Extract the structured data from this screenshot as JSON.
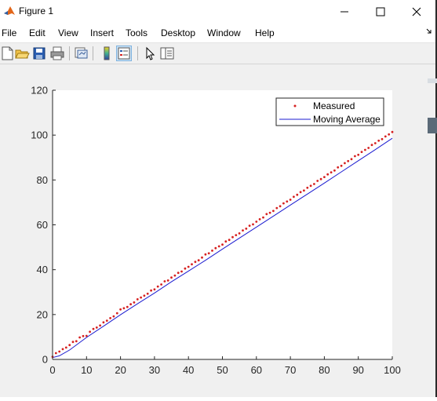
{
  "window": {
    "title": "Figure 1",
    "controls": [
      "minimize",
      "maximize",
      "close"
    ]
  },
  "menu": {
    "items": [
      "File",
      "Edit",
      "View",
      "Insert",
      "Tools",
      "Desktop",
      "Window",
      "Help"
    ]
  },
  "toolbar": {
    "buttons": [
      "new-figure-icon",
      "open-file-icon",
      "save-icon",
      "print-icon",
      "link-plot-icon",
      "insert-colorbar-icon",
      "insert-legend-icon",
      "pointer-icon",
      "property-inspector-icon"
    ],
    "active": "insert-legend-icon"
  },
  "colors": {
    "measured": "#d62020",
    "moving_average": "#1b1bd0",
    "figure_bg": "#f0f0f0",
    "axes_bg": "#ffffff"
  },
  "chart_data": {
    "type": "line",
    "xlim": [
      0,
      100
    ],
    "ylim": [
      0,
      120
    ],
    "xticks": [
      0,
      10,
      20,
      30,
      40,
      50,
      60,
      70,
      80,
      90,
      100
    ],
    "yticks": [
      0,
      20,
      40,
      60,
      80,
      100,
      120
    ],
    "grid": false,
    "legend_position": "top-right",
    "series": [
      {
        "name": "Measured",
        "style": "dots",
        "x": [
          0,
          1,
          2,
          3,
          4,
          5,
          6,
          7,
          8,
          9,
          10,
          11,
          12,
          13,
          14,
          15,
          16,
          17,
          18,
          19,
          20,
          21,
          22,
          23,
          24,
          25,
          26,
          27,
          28,
          29,
          30,
          31,
          32,
          33,
          34,
          35,
          36,
          37,
          38,
          39,
          40,
          41,
          42,
          43,
          44,
          45,
          46,
          47,
          48,
          49,
          50,
          51,
          52,
          53,
          54,
          55,
          56,
          57,
          58,
          59,
          60,
          61,
          62,
          63,
          64,
          65,
          66,
          67,
          68,
          69,
          70,
          71,
          72,
          73,
          74,
          75,
          76,
          77,
          78,
          79,
          80,
          81,
          82,
          83,
          84,
          85,
          86,
          87,
          88,
          89,
          90,
          91,
          92,
          93,
          94,
          95,
          96,
          97,
          98,
          99,
          100
        ],
        "values": [
          1.2,
          2.8,
          3.5,
          4.6,
          5.3,
          6.4,
          7.8,
          8.1,
          9.8,
          10.4,
          10.5,
          12.3,
          13.6,
          14.2,
          15.1,
          16.5,
          17.3,
          18.4,
          19.2,
          20.6,
          22.3,
          22.8,
          23.4,
          24.6,
          25.4,
          26.8,
          27.6,
          28.4,
          29.3,
          30.7,
          31.2,
          32.5,
          33.4,
          34.8,
          35.2,
          36.5,
          37.4,
          38.6,
          39.2,
          40.5,
          41.3,
          42.4,
          43.5,
          44.2,
          45.4,
          46.8,
          47.3,
          48.5,
          49.6,
          50.4,
          51.2,
          52.6,
          53.3,
          54.5,
          55.4,
          56.2,
          57.5,
          58.3,
          59.6,
          60.2,
          61.4,
          62.5,
          63.3,
          64.8,
          65.4,
          66.2,
          67.5,
          68.3,
          69.6,
          70.4,
          71.2,
          72.5,
          73.4,
          74.6,
          75.3,
          76.5,
          77.4,
          78.2,
          79.6,
          80.4,
          81.3,
          82.5,
          83.4,
          84.2,
          85.6,
          86.3,
          87.5,
          88.4,
          89.3,
          90.6,
          91.2,
          92.5,
          93.4,
          94.3,
          95.6,
          96.4,
          97.5,
          98.2,
          99.4,
          100.3,
          101.4
        ]
      },
      {
        "name": "Moving Average",
        "style": "line",
        "x": [
          0,
          2,
          5,
          10,
          15,
          20,
          25,
          30,
          35,
          40,
          45,
          50,
          55,
          60,
          65,
          70,
          75,
          80,
          85,
          90,
          95,
          100
        ],
        "values": [
          0.8,
          1.6,
          4.2,
          9.8,
          14.8,
          19.9,
          24.8,
          29.6,
          34.6,
          39.4,
          44.2,
          49.2,
          54.1,
          59.0,
          63.9,
          68.8,
          73.7,
          78.6,
          83.6,
          88.6,
          93.5,
          98.6
        ]
      }
    ]
  }
}
